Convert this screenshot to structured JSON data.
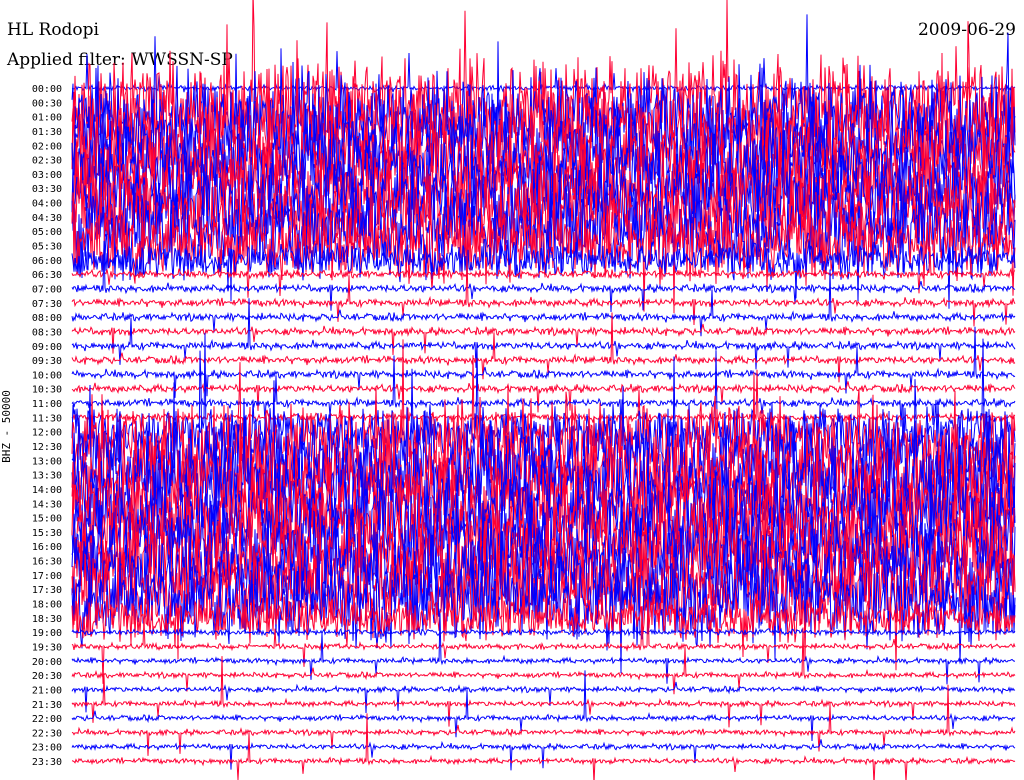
{
  "header": {
    "station": "HL Rodopi",
    "filter": "Applied filter: WWSSN-SP",
    "date": "2009-06-29"
  },
  "chart_data": {
    "type": "line",
    "title": "HL Rodopi",
    "subtitle": "Applied filter: WWSSN-SP",
    "ylabel": "BHZ - 50000",
    "xlabel": "",
    "colors": [
      "#0000ff",
      "#ff0033"
    ],
    "row_labels": [
      "00:00",
      "00:30",
      "01:00",
      "01:30",
      "02:00",
      "02:30",
      "03:00",
      "03:30",
      "04:00",
      "04:30",
      "05:00",
      "05:30",
      "06:00",
      "06:30",
      "07:00",
      "07:30",
      "08:00",
      "08:30",
      "09:00",
      "09:30",
      "10:00",
      "10:30",
      "11:00",
      "11:30",
      "12:00",
      "12:30",
      "13:00",
      "13:30",
      "14:00",
      "14:30",
      "15:00",
      "15:30",
      "16:00",
      "16:30",
      "17:00",
      "17:30",
      "18:00",
      "18:30",
      "19:00",
      "19:30",
      "20:00",
      "20:30",
      "21:00",
      "21:30",
      "22:00",
      "22:30",
      "23:00",
      "23:30"
    ],
    "relative_noise_level": [
      0.05,
      1,
      1,
      1,
      1,
      1,
      1,
      1,
      1,
      1,
      1,
      0.85,
      0.4,
      0.08,
      0.08,
      0.08,
      0.08,
      0.08,
      0.08,
      0.08,
      0.08,
      0.08,
      0.08,
      0.08,
      0.6,
      1,
      1,
      1,
      1,
      1,
      1,
      1,
      1,
      1,
      1,
      1,
      1,
      0.5,
      0.05,
      0.05,
      0.05,
      0.05,
      0.05,
      0.05,
      0.05,
      0.05,
      0.05,
      0.05
    ],
    "grid": false
  }
}
